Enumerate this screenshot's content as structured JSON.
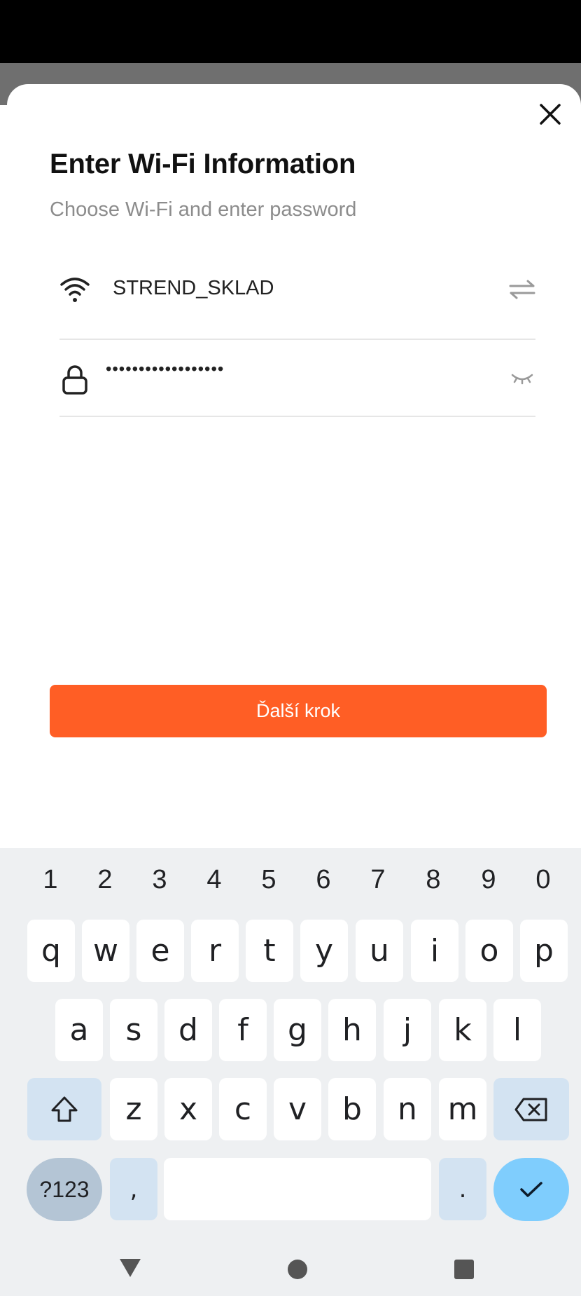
{
  "dialog": {
    "title": "Enter Wi-Fi Information",
    "subtitle": "Choose Wi-Fi and enter password",
    "close_icon": "close-icon"
  },
  "wifi": {
    "ssid": "STREND_SKLAD",
    "wifi_icon": "wifi-icon",
    "switch_icon": "switch-network-icon"
  },
  "password": {
    "masked_value": "••••••••••••••••••",
    "lock_icon": "lock-icon",
    "visibility_icon": "eye-closed-icon"
  },
  "next_button": {
    "label": "Ďalší krok"
  },
  "colors": {
    "accent": "#ff5e25",
    "keyboard_bg": "#eef0f2",
    "done_key": "#7fcdfd",
    "symbols_key": "#b4c5d5",
    "modifier_key": "#d3e3f2"
  },
  "keyboard": {
    "number_row": [
      "1",
      "2",
      "3",
      "4",
      "5",
      "6",
      "7",
      "8",
      "9",
      "0"
    ],
    "row1": [
      "q",
      "w",
      "e",
      "r",
      "t",
      "y",
      "u",
      "i",
      "o",
      "p"
    ],
    "row2": [
      "a",
      "s",
      "d",
      "f",
      "g",
      "h",
      "j",
      "k",
      "l"
    ],
    "row3": [
      "z",
      "x",
      "c",
      "v",
      "b",
      "n",
      "m"
    ],
    "symbols_label": "?123",
    "comma_label": ",",
    "period_label": ".",
    "shift_icon": "shift-icon",
    "backspace_icon": "backspace-icon",
    "done_icon": "checkmark-icon"
  },
  "nav": {
    "back_icon": "back-triangle-icon",
    "home_icon": "home-circle-icon",
    "recents_icon": "recents-square-icon"
  }
}
